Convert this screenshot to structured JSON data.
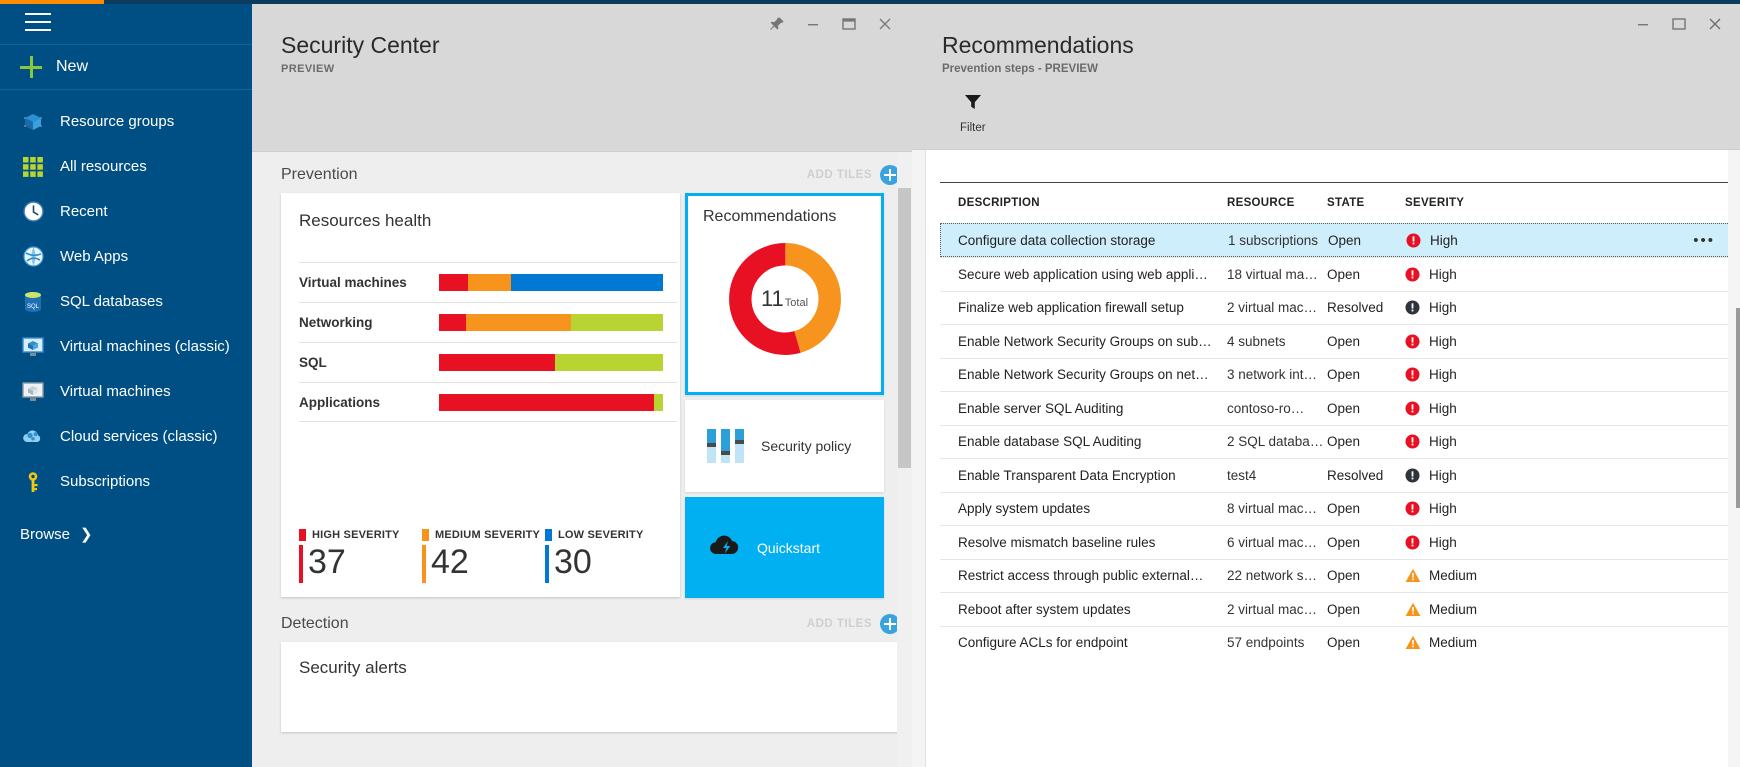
{
  "theme": {
    "azure_nav_bg": "#004f84",
    "accent_blue": "#00b0f0",
    "progress_orange": "#ff8c00",
    "high_red": "#e81123",
    "medium_orange": "#f7941e",
    "low_blue": "#0078d4",
    "healthy_green": "#b8d432",
    "resolved_dark": "#2f333d"
  },
  "nav": {
    "hamburger": "menu-icon",
    "new_label": "New",
    "items": [
      {
        "label": "Resource groups",
        "icon": "resource-groups-icon"
      },
      {
        "label": "All resources",
        "icon": "all-resources-icon"
      },
      {
        "label": "Recent",
        "icon": "clock-icon"
      },
      {
        "label": "Web Apps",
        "icon": "web-apps-icon"
      },
      {
        "label": "SQL databases",
        "icon": "sql-database-icon"
      },
      {
        "label": "Virtual machines (classic)",
        "icon": "virtual-machine-classic-icon"
      },
      {
        "label": "Virtual machines",
        "icon": "virtual-machine-icon"
      },
      {
        "label": "Cloud services (classic)",
        "icon": "cloud-services-icon"
      },
      {
        "label": "Subscriptions",
        "icon": "key-icon"
      }
    ],
    "browse_label": "Browse"
  },
  "security_center": {
    "title": "Security Center",
    "subtitle": "PREVIEW",
    "window_buttons": [
      "pin-icon",
      "minimize-icon",
      "maximize-icon",
      "close-icon"
    ],
    "prevention_label": "Prevention",
    "detection_label": "Detection",
    "add_tiles_label": "ADD TILES",
    "resources_health": {
      "title": "Resources health",
      "rows": [
        {
          "label": "Virtual machines",
          "segments": [
            {
              "name": "high",
              "color": "#e81123",
              "pct": 13.0
            },
            {
              "name": "medium",
              "color": "#f7941e",
              "pct": 19.0
            },
            {
              "name": "low",
              "color": "#0078d4",
              "pct": 68.0
            }
          ]
        },
        {
          "label": "Networking",
          "segments": [
            {
              "name": "high",
              "color": "#e81123",
              "pct": 12.0
            },
            {
              "name": "medium",
              "color": "#f7941e",
              "pct": 47.0
            },
            {
              "name": "healthy",
              "color": "#b8d432",
              "pct": 41.0
            }
          ]
        },
        {
          "label": "SQL",
          "segments": [
            {
              "name": "high",
              "color": "#e81123",
              "pct": 52.0
            },
            {
              "name": "healthy",
              "color": "#b8d432",
              "pct": 48.0
            }
          ]
        },
        {
          "label": "Applications",
          "segments": [
            {
              "name": "high",
              "color": "#e81123",
              "pct": 96.0
            },
            {
              "name": "healthy",
              "color": "#b8d432",
              "pct": 4.0
            }
          ]
        }
      ],
      "severity_counters": [
        {
          "label": "HIGH SEVERITY",
          "value": "37",
          "color": "#e81123"
        },
        {
          "label": "MEDIUM SEVERITY",
          "value": "42",
          "color": "#f7941e"
        },
        {
          "label": "LOW SEVERITY",
          "value": "30",
          "color": "#0078d4"
        }
      ]
    },
    "recommendations_tile": {
      "title": "Recommendations",
      "total_value": "11",
      "total_label": "Total",
      "donut": [
        {
          "name": "medium",
          "color": "#f7941e",
          "value": 5
        },
        {
          "name": "high",
          "color": "#e81123",
          "value": 6
        }
      ]
    },
    "security_policy_tile": {
      "label": "Security policy",
      "icon": "sliders-icon"
    },
    "quickstart_tile": {
      "label": "Quickstart",
      "icon": "cloud-lightning-icon"
    },
    "security_alerts_tile": {
      "title": "Security alerts"
    }
  },
  "recommendations_blade": {
    "title": "Recommendations",
    "subtitle": "Prevention steps - PREVIEW",
    "filter_label": "Filter",
    "window_buttons": [
      "minimize-icon",
      "maximize-icon",
      "close-icon"
    ],
    "columns": [
      "DESCRIPTION",
      "RESOURCE",
      "STATE",
      "SEVERITY"
    ],
    "rows": [
      {
        "description": "Configure data collection storage",
        "resource": "1 subscriptions",
        "state": "Open",
        "severity": "High",
        "sev_kind": "high-open",
        "selected": true,
        "has_menu": true
      },
      {
        "description": "Secure web application using web appli…",
        "resource": "18 virtual ma…",
        "state": "Open",
        "severity": "High",
        "sev_kind": "high-open",
        "selected": false,
        "has_menu": false
      },
      {
        "description": "Finalize web application firewall setup",
        "resource": "2 virtual mac…",
        "state": "Resolved",
        "severity": "High",
        "sev_kind": "high-resolved",
        "selected": false,
        "has_menu": false
      },
      {
        "description": "Enable Network Security Groups on sub…",
        "resource": "4 subnets",
        "state": "Open",
        "severity": "High",
        "sev_kind": "high-open",
        "selected": false,
        "has_menu": false
      },
      {
        "description": "Enable Network Security Groups on net…",
        "resource": "3 network int…",
        "state": "Open",
        "severity": "High",
        "sev_kind": "high-open",
        "selected": false,
        "has_menu": false
      },
      {
        "description": "Enable server SQL Auditing",
        "resource": "contoso-ro…",
        "state": "Open",
        "severity": "High",
        "sev_kind": "high-open",
        "selected": false,
        "has_menu": false,
        "resource_muted": true
      },
      {
        "description": "Enable database SQL Auditing",
        "resource": "2 SQL databa…",
        "state": "Open",
        "severity": "High",
        "sev_kind": "high-open",
        "selected": false,
        "has_menu": false
      },
      {
        "description": "Enable Transparent Data Encryption",
        "resource": "test4",
        "state": "Resolved",
        "severity": "High",
        "sev_kind": "high-resolved",
        "selected": false,
        "has_menu": false
      },
      {
        "description": "Apply system updates",
        "resource": "8 virtual mac…",
        "state": "Open",
        "severity": "High",
        "sev_kind": "high-open",
        "selected": false,
        "has_menu": false
      },
      {
        "description": "Resolve mismatch baseline rules",
        "resource": "6 virtual mac…",
        "state": "Open",
        "severity": "High",
        "sev_kind": "high-open",
        "selected": false,
        "has_menu": false
      },
      {
        "description": "Restrict access through public external…",
        "resource": "22 network s…",
        "state": "Open",
        "severity": "Medium",
        "sev_kind": "medium",
        "selected": false,
        "has_menu": false
      },
      {
        "description": "Reboot after system updates",
        "resource": "2 virtual mac…",
        "state": "Open",
        "severity": "Medium",
        "sev_kind": "medium",
        "selected": false,
        "has_menu": false
      },
      {
        "description": "Configure ACLs for endpoint",
        "resource": "57 endpoints",
        "state": "Open",
        "severity": "Medium",
        "sev_kind": "medium",
        "selected": false,
        "has_menu": false
      }
    ]
  }
}
